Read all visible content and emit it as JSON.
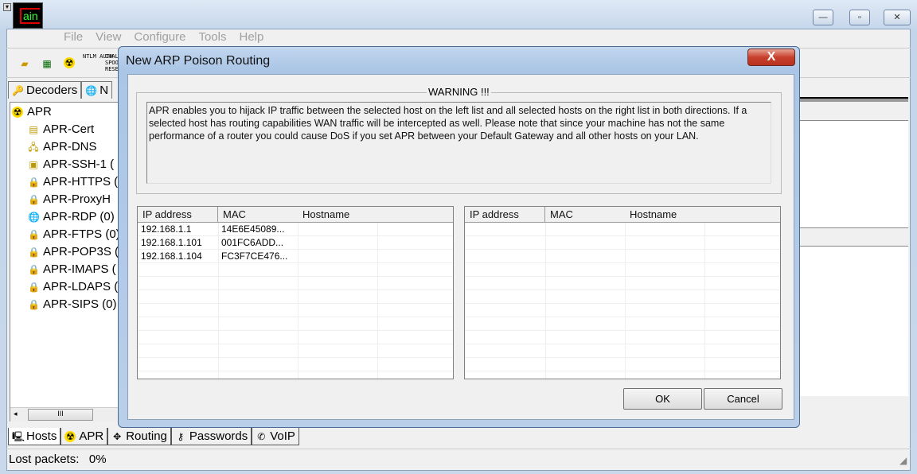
{
  "app": {
    "logo_text": "Cain"
  },
  "menu": [
    "File",
    "View",
    "Configure",
    "Tools",
    "Help"
  ],
  "window_controls": {
    "minimize": "—",
    "maximize": "▫",
    "close": "✕"
  },
  "toolbar": {
    "ntlm": "NTLM AUTH",
    "chal": "CHAL SPOO RESE"
  },
  "top_tabs": [
    {
      "label": "Decoders",
      "icon": "key-icon"
    },
    {
      "label": "N",
      "icon": "globe-icon"
    }
  ],
  "tree": {
    "root": "APR",
    "items": [
      {
        "label": "APR-Cert",
        "icon": "certificate-icon"
      },
      {
        "label": "APR-DNS",
        "icon": "network-icon"
      },
      {
        "label": "APR-SSH-1 (",
        "icon": "terminal-icon"
      },
      {
        "label": "APR-HTTPS (",
        "icon": "lock-icon"
      },
      {
        "label": "APR-ProxyH",
        "icon": "lock-icon"
      },
      {
        "label": "APR-RDP (0)",
        "icon": "globe-icon"
      },
      {
        "label": "APR-FTPS (0)",
        "icon": "lock-icon"
      },
      {
        "label": "APR-POP3S (",
        "icon": "lock-icon"
      },
      {
        "label": "APR-IMAPS (",
        "icon": "lock-icon"
      },
      {
        "label": "APR-LDAPS (",
        "icon": "lock-icon"
      },
      {
        "label": "APR-SIPS (0)",
        "icon": "lock-icon"
      }
    ]
  },
  "bottom_tabs": [
    {
      "label": "Hosts",
      "icon": "computer-icon"
    },
    {
      "label": "APR",
      "icon": "radiation-icon"
    },
    {
      "label": "Routing",
      "icon": "move-icon"
    },
    {
      "label": "Passwords",
      "icon": "keys-icon"
    },
    {
      "label": "VoIP",
      "icon": "phone-icon"
    }
  ],
  "status": {
    "text": "Lost packets:   0%"
  },
  "dialog": {
    "title": "New ARP Poison Routing",
    "close": "X",
    "warning_label": "WARNING !!!",
    "warning_text": "APR enables you to hijack IP traffic between the selected host on the left list and all selected hosts on the right list in both directions. If a selected host has routing capabilities WAN traffic will be intercepted as well. Please note that since your machine has not the same performance of a router you could cause DoS if you set APR between your Default Gateway and all other hosts on your LAN.",
    "columns": [
      "IP address",
      "MAC",
      "Hostname"
    ],
    "left_rows": [
      [
        "192.168.1.1",
        "14E6E45089...",
        ""
      ],
      [
        "192.168.1.101",
        "001FC6ADD...",
        ""
      ],
      [
        "192.168.1.104",
        "FC3F7CE476...",
        ""
      ]
    ],
    "right_rows": [],
    "ok": "OK",
    "cancel": "Cancel"
  }
}
